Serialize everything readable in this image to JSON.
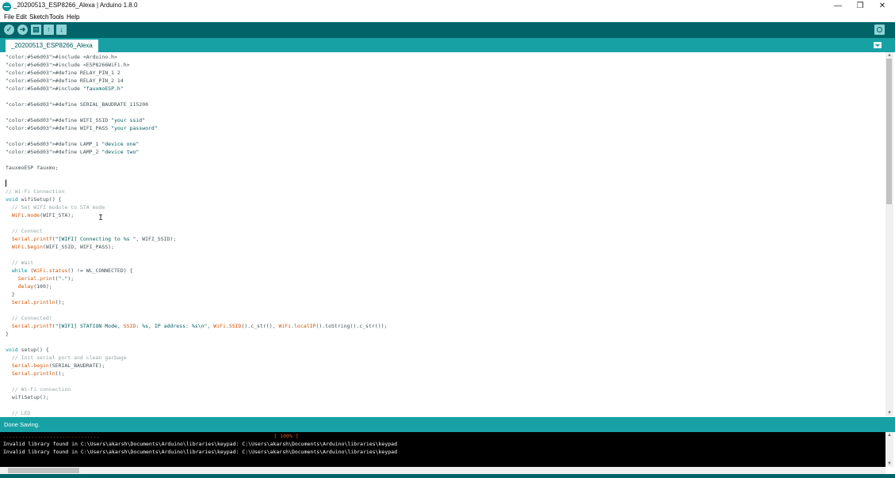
{
  "window": {
    "title": "_20200513_ESP8266_Alexa | Arduino 1.8.0",
    "minimize": "—",
    "restore": "❐",
    "close": "✕"
  },
  "menu": [
    "File",
    "Edit",
    "Sketch",
    "Tools",
    "Help"
  ],
  "toolbar": {
    "verify": "✓",
    "upload": "➜",
    "new": "▤",
    "open": "↑",
    "save": "↓",
    "serial_monitor_icon": "magnifier-icon"
  },
  "tab": {
    "name": "_20200513_ESP8266_Alexa"
  },
  "colors": {
    "toolbar": "#006468",
    "accent": "#17a1a5",
    "console_bg": "#000000",
    "progress": "#d35b1f"
  },
  "code": [
    "#include <Arduino.h>",
    "#include <ESP8266WiFi.h>",
    "#define RELAY_PIN_1 2",
    "#define RELAY_PIN_2 14",
    "#include \"fauxmoESP.h\"",
    "",
    "#define SERIAL_BAUDRATE 115200",
    "",
    "#define WIFI_SSID \"your ssid\"",
    "#define WIFI_PASS \"your password\"",
    "",
    "#define LAMP_1 \"device one\"",
    "#define LAMP_2 \"device two\"",
    "",
    "fauxmoESP fauxmo;",
    "",
    "",
    "// Wi-Fi Connection",
    "void wifiSetup() {",
    "  // Set WIFI module to STA mode",
    "  WiFi.mode(WIFI_STA);",
    "",
    "  // Connect",
    "  Serial.printf(\"[WIFI] Connecting to %s \", WIFI_SSID);",
    "  WiFi.begin(WIFI_SSID, WIFI_PASS);",
    "",
    "  // Wait",
    "  while (WiFi.status() != WL_CONNECTED) {",
    "    Serial.print(\".\");",
    "    delay(100);",
    "  }",
    "  Serial.println();",
    "",
    "  // Connected!",
    "  Serial.printf(\"[WIFI] STATION Mode, SSID: %s, IP address: %s\\n\", WiFi.SSID().c_str(), WiFi.localIP().toString().c_str());",
    "}",
    "",
    "void setup() {",
    "  // Init serial port and clean garbage",
    "  Serial.begin(SERIAL_BAUDRATE);",
    "  Serial.println();",
    "",
    "  // Wi-Fi connection",
    "  wifiSetup();",
    "",
    "  // LED"
  ],
  "status": {
    "message": "Done Saving."
  },
  "console": {
    "progress_dots": "...............................",
    "progress_label": "[ 100% ]",
    "lines": [
      "Invalid library found in C:\\Users\\akarsh\\Documents\\Arduino\\libraries\\keypad: C:\\Users\\akarsh\\Documents\\Arduino\\libraries\\keypad",
      "Invalid library found in C:\\Users\\akarsh\\Documents\\Arduino\\libraries\\keypad: C:\\Users\\akarsh\\Documents\\Arduino\\libraries\\keypad"
    ]
  }
}
